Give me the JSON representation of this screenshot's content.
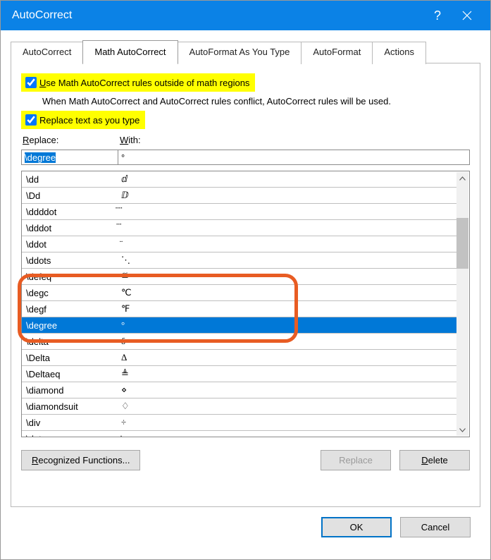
{
  "titlebar": {
    "title": "AutoCorrect",
    "help": "?",
    "close": "×"
  },
  "tabs": [
    "AutoCorrect",
    "Math AutoCorrect",
    "AutoFormat As You Type",
    "AutoFormat",
    "Actions"
  ],
  "active_tab": 1,
  "checkbox1": {
    "label_pre": "U",
    "label_rest": "se Math AutoCorrect rules outside of math regions",
    "checked": true
  },
  "note": "When Math AutoCorrect and AutoCorrect rules conflict, AutoCorrect rules will be used.",
  "checkbox2": {
    "label": "Replace text as you type",
    "checked": true
  },
  "labels": {
    "replace_pre": "R",
    "replace_rest": "eplace:",
    "with_pre": "W",
    "with_rest": "ith:"
  },
  "inputs": {
    "replace": "\\degree",
    "with": "°"
  },
  "rows": [
    {
      "r": "\\dd",
      "w": "ⅆ"
    },
    {
      "r": "\\Dd",
      "w": "ⅅ"
    },
    {
      "r": "\\ddddot",
      "w": "⃜"
    },
    {
      "r": "\\dddot",
      "w": "⃛"
    },
    {
      "r": "\\ddot",
      "w": "̈"
    },
    {
      "r": "\\ddots",
      "w": "⋱"
    },
    {
      "r": "\\defeq",
      "w": "≝"
    },
    {
      "r": "\\degc",
      "w": "℃"
    },
    {
      "r": "\\degf",
      "w": "℉"
    },
    {
      "r": "\\degree",
      "w": "°",
      "selected": true
    },
    {
      "r": "\\delta",
      "w": "δ"
    },
    {
      "r": "\\Delta",
      "w": "Δ"
    },
    {
      "r": "\\Deltaeq",
      "w": "≜"
    },
    {
      "r": "\\diamond",
      "w": "⋄"
    },
    {
      "r": "\\diamondsuit",
      "w": "♢"
    },
    {
      "r": "\\div",
      "w": "÷"
    },
    {
      "r": "\\dot",
      "w": "̇"
    }
  ],
  "buttons": {
    "recognized": "Recognized Functions...",
    "replace": "Replace",
    "delete_pre": "D",
    "delete_rest": "elete",
    "ok": "OK",
    "cancel": "Cancel"
  }
}
